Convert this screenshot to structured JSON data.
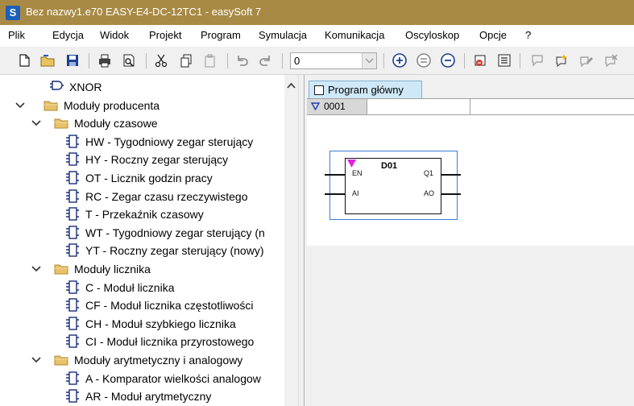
{
  "window": {
    "title": "Bez nazwy1.e70 EASY-E4-DC-12TC1 - easySoft 7",
    "app_icon": "S"
  },
  "menu": [
    "Plik",
    "Edycja",
    "Widok",
    "Projekt",
    "Program",
    "Symulacja",
    "Komunikacja",
    "Oscyloskop",
    "Opcje",
    "?"
  ],
  "toolbar": {
    "zoom_value": "0"
  },
  "tree": {
    "items": [
      {
        "label": "XNOR"
      },
      {
        "label": "Moduły producenta"
      },
      {
        "label": "Moduły czasowe"
      },
      {
        "label": "HW - Tygodniowy zegar sterujący"
      },
      {
        "label": "HY - Roczny zegar sterujący"
      },
      {
        "label": "OT - Licznik godzin pracy"
      },
      {
        "label": "RC - Zegar czasu rzeczywistego"
      },
      {
        "label": "T - Przekaźnik czasowy"
      },
      {
        "label": "WT - Tygodniowy zegar sterujący (n"
      },
      {
        "label": "YT - Roczny zegar sterujący (nowy)"
      },
      {
        "label": "Moduły licznika"
      },
      {
        "label": "C - Moduł licznika"
      },
      {
        "label": "CF - Moduł licznika częstotliwości"
      },
      {
        "label": "CH - Moduł szybkiego licznika"
      },
      {
        "label": "CI - Moduł licznika przyrostowego"
      },
      {
        "label": "Moduły arytmetyczny i analogowy"
      },
      {
        "label": "A - Komparator wielkości analogow"
      },
      {
        "label": "AR - Moduł arytmetyczny"
      }
    ]
  },
  "editor": {
    "tab_label": "Program główny",
    "row_number": "0001",
    "block": {
      "name": "D01",
      "in1": "EN",
      "in2": "AI",
      "out1": "Q1",
      "out2": "AO"
    }
  },
  "colors": {
    "titlebar": "#a88a45",
    "tab": "#cfe8f8",
    "block_frame": "#3d7fd0",
    "enable_marker": "#e020e0"
  }
}
